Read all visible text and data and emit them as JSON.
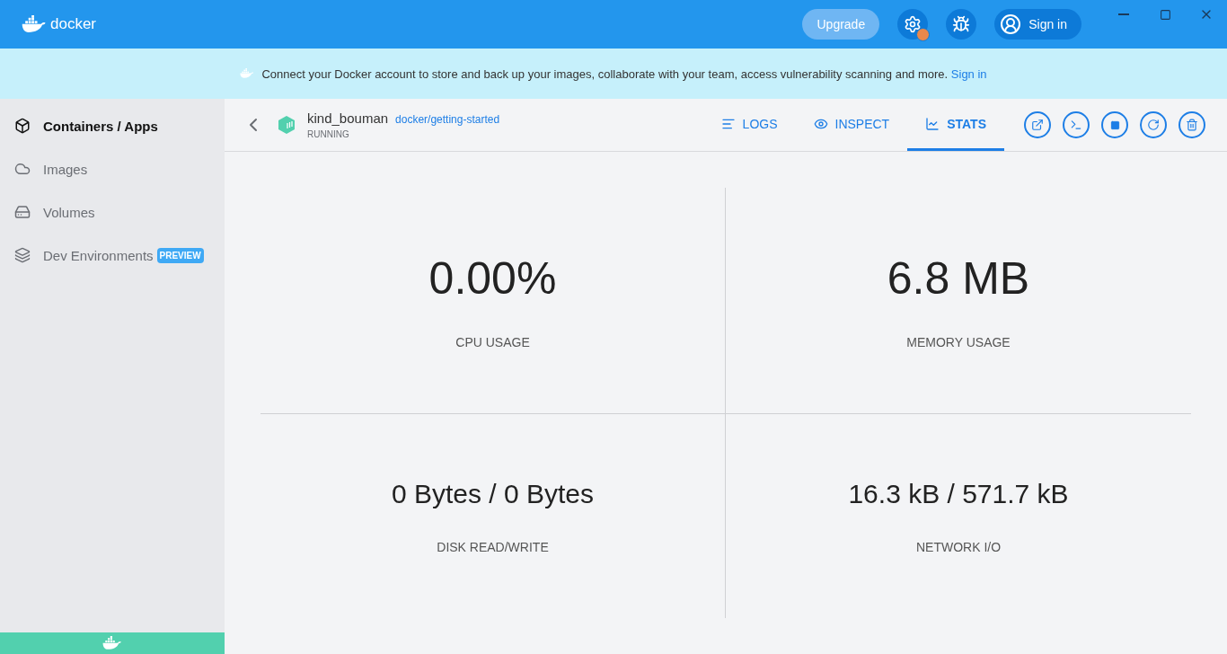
{
  "header": {
    "logo": "docker",
    "upgrade": "Upgrade",
    "sign_in": "Sign in",
    "settings_alert": true
  },
  "banner": {
    "text": "Connect your Docker account to store and back up your images, collaborate with your team, access vulnerability scanning and more.",
    "link": "Sign in"
  },
  "sidebar": {
    "items": [
      {
        "kind": "containers",
        "label": "Containers / Apps",
        "selected": true
      },
      {
        "kind": "images",
        "label": "Images",
        "selected": false
      },
      {
        "kind": "volumes",
        "label": "Volumes",
        "selected": false
      },
      {
        "kind": "dev",
        "label": "Dev Environments",
        "selected": false,
        "badge": "PREVIEW"
      }
    ]
  },
  "container": {
    "name": "kind_bouman",
    "image": "docker/getting-started",
    "status": "RUNNING"
  },
  "tabs": [
    {
      "kind": "logs",
      "label": "LOGS",
      "selected": false
    },
    {
      "kind": "inspect",
      "label": "INSPECT",
      "selected": false
    },
    {
      "kind": "stats",
      "label": "STATS",
      "selected": true
    }
  ],
  "stats": [
    {
      "value": "0.00%",
      "label": "CPU USAGE"
    },
    {
      "value": "6.8 MB",
      "label": "MEMORY USAGE"
    },
    {
      "value": "0 Bytes / 0 Bytes",
      "label": "DISK READ/WRITE"
    },
    {
      "value": "16.3 kB / 571.7 kB",
      "label": "NETWORK I/O"
    }
  ]
}
